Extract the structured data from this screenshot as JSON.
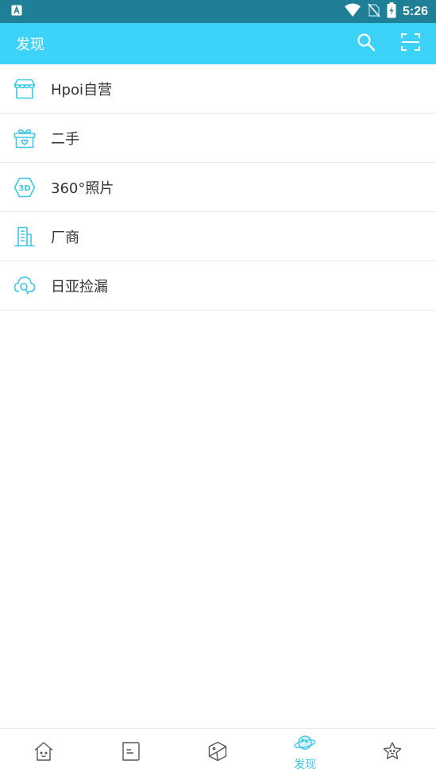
{
  "status_bar": {
    "time": "5:26"
  },
  "app_bar": {
    "title": "发现"
  },
  "list": {
    "items": [
      {
        "label": "Hpoi自营",
        "icon": "store-icon"
      },
      {
        "label": "二手",
        "icon": "gift-box-icon"
      },
      {
        "label": "360°照片",
        "icon": "3d-hexagon-icon"
      },
      {
        "label": "厂商",
        "icon": "building-icon"
      },
      {
        "label": "日亚捡漏",
        "icon": "cloud-search-icon"
      }
    ]
  },
  "bottom_nav": {
    "tabs": [
      {
        "icon": "home-face-icon",
        "label": ""
      },
      {
        "icon": "note-icon",
        "label": ""
      },
      {
        "icon": "cube-icon",
        "label": ""
      },
      {
        "icon": "planet-icon",
        "label": "发现",
        "active": true
      },
      {
        "icon": "star-face-icon",
        "label": ""
      }
    ]
  },
  "colors": {
    "accent": "#3dd2f7",
    "status_bar": "#1f7f96",
    "icon": "#3cc6e6"
  }
}
